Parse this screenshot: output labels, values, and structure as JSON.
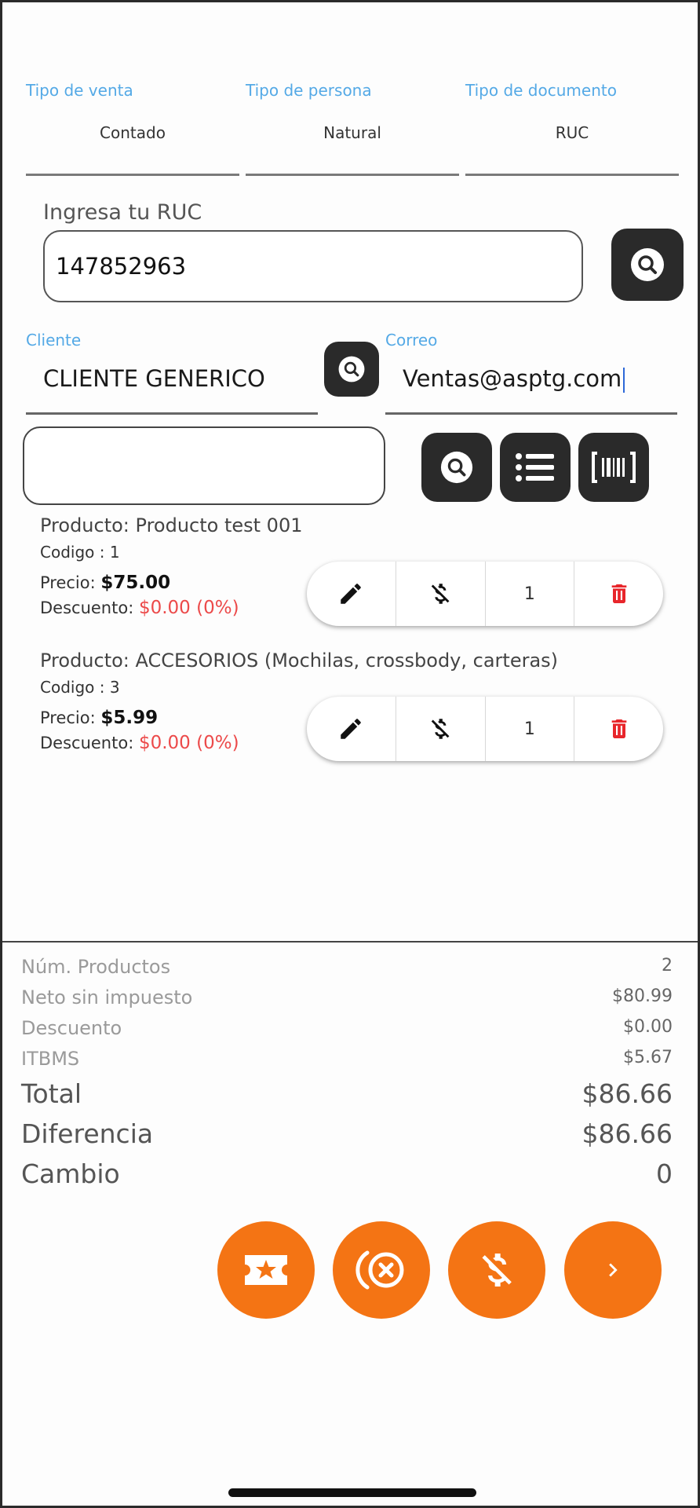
{
  "selectors": [
    {
      "label": "Tipo de venta",
      "value": "Contado"
    },
    {
      "label": "Tipo de persona",
      "value": "Natural"
    },
    {
      "label": "Tipo de documento",
      "value": "RUC"
    }
  ],
  "ruc": {
    "label": "Ingresa tu RUC",
    "value": "147852963"
  },
  "cliente": {
    "label": "Cliente",
    "value": "CLIENTE GENERICO"
  },
  "correo": {
    "label": "Correo",
    "value": "Ventas@asptg.com"
  },
  "product_search": {
    "value": ""
  },
  "products": [
    {
      "name": "Producto: Producto test 001",
      "code": "Codigo : 1",
      "price_label": "Precio:",
      "price": "$75.00",
      "discount_label": "Descuento:",
      "discount": "$0.00 (0%)",
      "qty": "1"
    },
    {
      "name": "Producto: ACCESORIOS  (Mochilas, crossbody, carteras)",
      "code": "Codigo : 3",
      "price_label": "Precio:",
      "price": "$5.99",
      "discount_label": "Descuento:",
      "discount": "$0.00 (0%)",
      "qty": "1"
    }
  ],
  "summary": {
    "num_productos": {
      "label": "Núm. Productos",
      "value": "2"
    },
    "neto": {
      "label": "Neto sin impuesto",
      "value": "$80.99"
    },
    "descuento": {
      "label": "Descuento",
      "value": "$0.00"
    },
    "itbms": {
      "label": "ITBMS",
      "value": "$5.67"
    },
    "total": {
      "label": "Total",
      "value": "$86.66"
    },
    "diferencia": {
      "label": "Diferencia",
      "value": "$86.66"
    },
    "cambio": {
      "label": "Cambio",
      "value": "0"
    }
  },
  "colors": {
    "accent": "#f47414",
    "label_blue": "#54a9e6",
    "danger": "#e8262b",
    "dark": "#2a2a2a"
  },
  "icons": [
    "search-icon",
    "list-icon",
    "barcode-icon",
    "pencil-icon",
    "no-money-icon",
    "trash-icon",
    "ticket-star-icon",
    "cancel-circle-icon",
    "next-icon"
  ]
}
